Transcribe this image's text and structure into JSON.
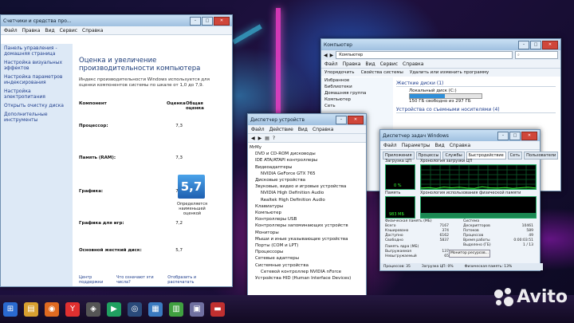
{
  "window_perf": {
    "title": "Счетчики и средства про...",
    "menu": [
      "Файл",
      "Правка",
      "Вид",
      "Сервис",
      "Справка"
    ],
    "sidebar": [
      "Панель управления - домашняя страница",
      "Настройка визуальных эффектов",
      "Настройка параметров индексирования",
      "Настройка электропитания",
      "Открыть очистку диска",
      "Дополнительные инструменты"
    ],
    "heading": "Оценка и увеличение производительности компьютера",
    "description": "Индекс производительности Windows используется для оценки компонентов системы по шкале от 1,0 до 7,9.",
    "col_component": "Компонент",
    "col_score": "Оценка",
    "col_overall": "Общая оценка",
    "rows": [
      {
        "name": "Процессор:",
        "score": "7,3"
      },
      {
        "name": "Память (RAM):",
        "score": "7,3"
      },
      {
        "name": "Графика:",
        "score": "7,2"
      },
      {
        "name": "Графика для игр:",
        "score": "7,2"
      },
      {
        "name": "Основной жесткий диск:",
        "score": "5,7"
      }
    ],
    "overall": "5,7",
    "overall_caption": "Определяется наименьшей оценкой",
    "footer_left": "Центр поддержки",
    "footer_mid": "Что означают эти числа?",
    "footer_right": "Отобразить и распечатать"
  },
  "window_devmgr": {
    "title": "Диспетчер устройств",
    "menu": [
      "Файл",
      "Действие",
      "Вид",
      "Справка"
    ],
    "tree": [
      "MrMy",
      "DVD и CD-ROM дисководы",
      "IDE ATA/ATAPI контроллеры",
      "Видеоадаптеры",
      "NVIDIA GeForce GTX 765",
      "Дисковые устройства",
      "Звуковые, видео и игровые устройства",
      "NVIDIA High Definition Audio",
      "Realtek High Definition Audio",
      "Клавиатуры",
      "Компьютер",
      "Контроллеры USB",
      "Контроллеры запоминающих устройств",
      "Мониторы",
      "Мыши и иные указывающие устройства",
      "Порты (COM и LPT)",
      "Процессоры",
      "Сетевые адаптеры",
      "Системные устройства",
      "Сетевой контроллер NVIDIA nForce",
      "Устройства HID (Human Interface Devices)"
    ]
  },
  "window_explorer": {
    "title": "Компьютер",
    "menu": [
      "Файл",
      "Правка",
      "Вид",
      "Сервис",
      "Справка"
    ],
    "toolbar": [
      "Упорядочить",
      "Свойства системы",
      "Удалить или изменить программу"
    ],
    "nav": [
      "Избранное",
      "Библиотеки",
      "Домашняя группа",
      "Компьютер",
      "Сеть"
    ],
    "section_hdd": "Жесткие диски (1)",
    "disk_name": "Локальный диск (C:)",
    "disk_free": "150 ГБ свободно из 297 ГБ",
    "disk_used_fraction": 0.49,
    "section_removable": "Устройства со съемными носителями (4)"
  },
  "window_taskmgr": {
    "title": "Диспетчер задач Windows",
    "menu": [
      "Файл",
      "Параметры",
      "Вид",
      "Справка"
    ],
    "tabs": [
      "Приложения",
      "Процессы",
      "Службы",
      "Быстродействие",
      "Сеть",
      "Пользователи"
    ],
    "active_tab": "Быстродействие",
    "cpu_label": "Загрузка ЦП",
    "cpu_history_label": "Хронология загрузки ЦП",
    "cpu_value": "0 %",
    "mem_label": "Память",
    "mem_history_label": "Хронология использования физической памяти",
    "mem_value": "983 МБ",
    "cpu_history": [
      4,
      6,
      3,
      8,
      5,
      7,
      4,
      3,
      9,
      5,
      4,
      6,
      3,
      5,
      7,
      4
    ],
    "stats_phys": [
      [
        "Всего",
        "7167"
      ],
      [
        "Кэшировано",
        "374"
      ],
      [
        "Доступно",
        "6162"
      ],
      [
        "Свободно",
        "5837"
      ]
    ],
    "stats_sys": [
      [
        "Дескрипторов",
        "10461"
      ],
      [
        "Потоков",
        "589"
      ],
      [
        "Процессов",
        "49"
      ],
      [
        "Время работы",
        "0:00:03:51"
      ],
      [
        "Выделено (ГБ)",
        "1 / 13"
      ]
    ],
    "phys_label": "Физическая память (МБ)",
    "sys_label": "Система",
    "kernel_label": "Память ядра (МБ)",
    "kernel_stats": [
      [
        "Выгружаемая",
        "137"
      ],
      [
        "Невыгружаемый",
        "65"
      ]
    ],
    "monitor_button": "Монитор ресурсов...",
    "status": [
      "Процессов: 35",
      "Загрузка ЦП: 0%",
      "Физическая память: 13%"
    ]
  },
  "taskbar": {
    "icons": [
      {
        "name": "start-icon",
        "glyph": "⊞",
        "color": "#2a6ad0"
      },
      {
        "name": "explorer-icon",
        "glyph": "▤",
        "color": "#d8a030"
      },
      {
        "name": "firefox-icon",
        "glyph": "◉",
        "color": "#e06a20"
      },
      {
        "name": "yandex-icon",
        "glyph": "Y",
        "color": "#e03030"
      },
      {
        "name": "gamepad-icon",
        "glyph": "◈",
        "color": "#555"
      },
      {
        "name": "media-icon",
        "glyph": "▶",
        "color": "#20a060"
      },
      {
        "name": "steam-icon",
        "glyph": "◎",
        "color": "#2a4a7a"
      },
      {
        "name": "perfmon-icon",
        "glyph": "▦",
        "color": "#3a7ac0"
      },
      {
        "name": "taskmgr-icon",
        "glyph": "▥",
        "color": "#40a040"
      },
      {
        "name": "devmgr-icon",
        "glyph": "▣",
        "color": "#7070a0"
      },
      {
        "name": "app-icon",
        "glyph": "▬",
        "color": "#c03030"
      }
    ]
  },
  "watermark": "Avito"
}
